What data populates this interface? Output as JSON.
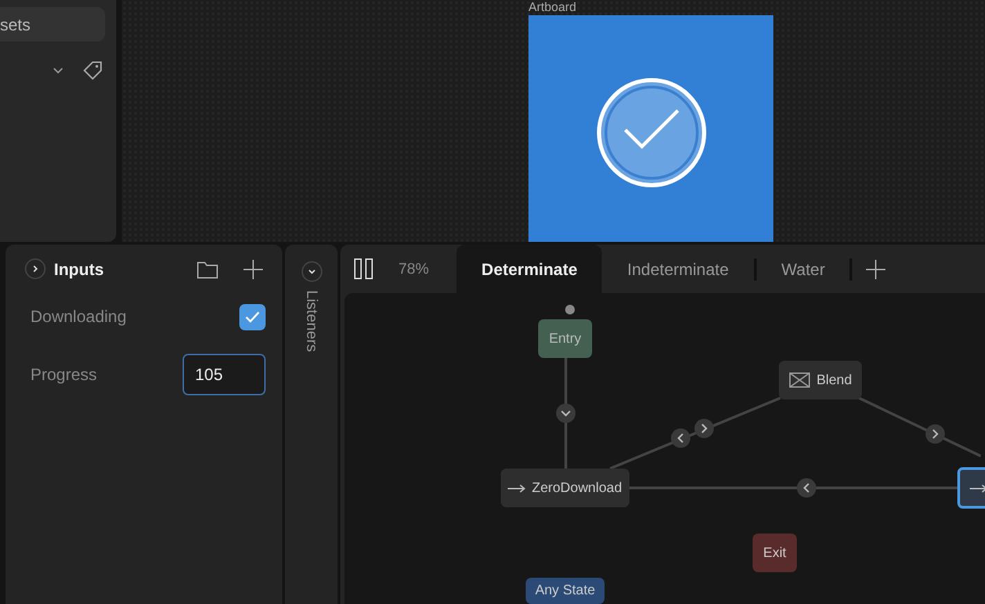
{
  "assets_panel": {
    "search": {
      "value": "sets"
    }
  },
  "artboard": {
    "label": "Artboard"
  },
  "inputs_panel": {
    "title": "Inputs",
    "inputs": [
      {
        "kind": "boolean",
        "name": "Downloading",
        "checked": true
      },
      {
        "kind": "number",
        "name": "Progress",
        "value": "105"
      }
    ]
  },
  "listeners_panel": {
    "title": "Listeners"
  },
  "graph": {
    "zoom": "78%",
    "tabs": [
      {
        "label": "Determinate",
        "selected": true
      },
      {
        "label": "Indeterminate",
        "selected": false
      },
      {
        "label": "Water",
        "selected": false
      }
    ],
    "nodes": [
      {
        "kind": "entry",
        "label": "Entry"
      },
      {
        "kind": "blend",
        "label": "Blend"
      },
      {
        "kind": "state",
        "label": "ZeroDownload"
      },
      {
        "kind": "exit",
        "label": "Exit"
      },
      {
        "kind": "any",
        "label": "Any State"
      },
      {
        "kind": "state",
        "selected": true
      }
    ]
  }
}
